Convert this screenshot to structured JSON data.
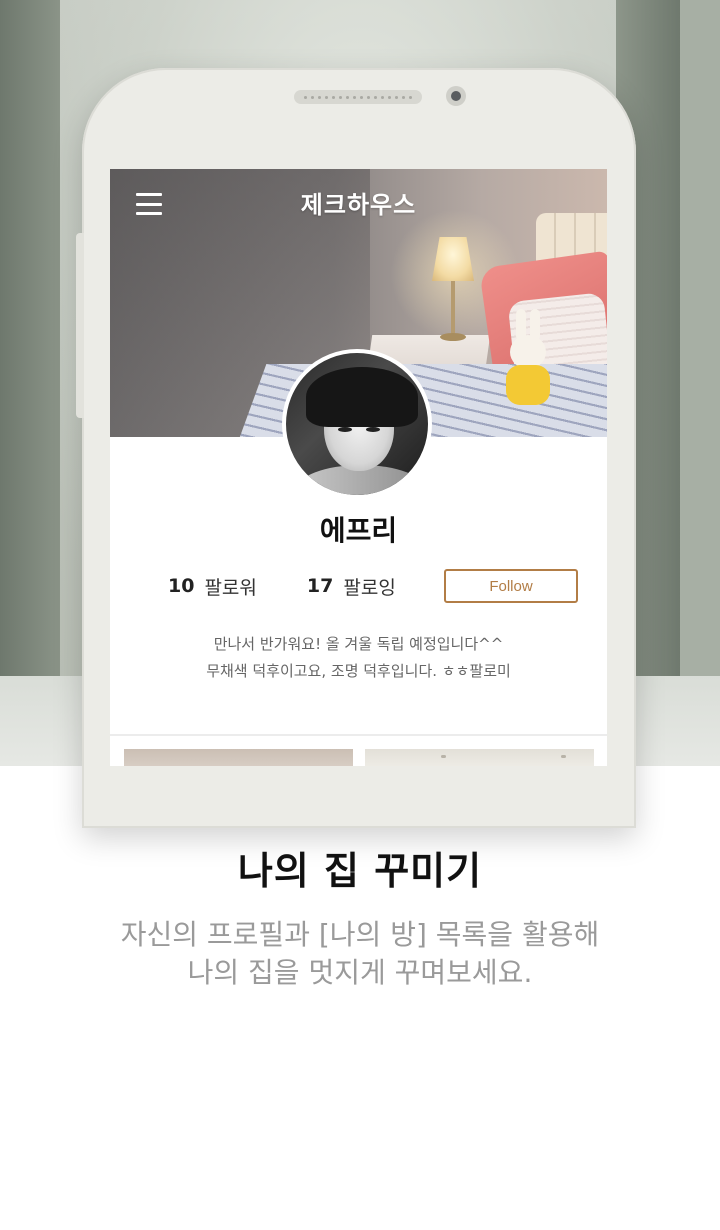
{
  "screen": {
    "app_title": "제크하우스",
    "profile": {
      "username": "에프리",
      "followers_count": "10",
      "followers_label": "팔로워",
      "following_count": "17",
      "following_label": "팔로잉",
      "follow_button": "Follow",
      "bio_line1": "만나서 반가워요! 올 겨울 독립 예정입니다^^",
      "bio_line2": "무채색 덕후이고요, 조명 덕후입니다. ㅎㅎ팔로미"
    }
  },
  "caption": {
    "title": "나의 집 꾸미기",
    "description_line1": "자신의 프로필과 [나의 방] 목록을 활용해",
    "description_line2": "나의 집을 멋지게 꾸며보세요."
  },
  "colors": {
    "follow_accent": "#b27d46",
    "caption_gray": "#9a9a9a",
    "phone_body": "#ecece7"
  },
  "icons": [
    "hamburger-menu-icon"
  ]
}
